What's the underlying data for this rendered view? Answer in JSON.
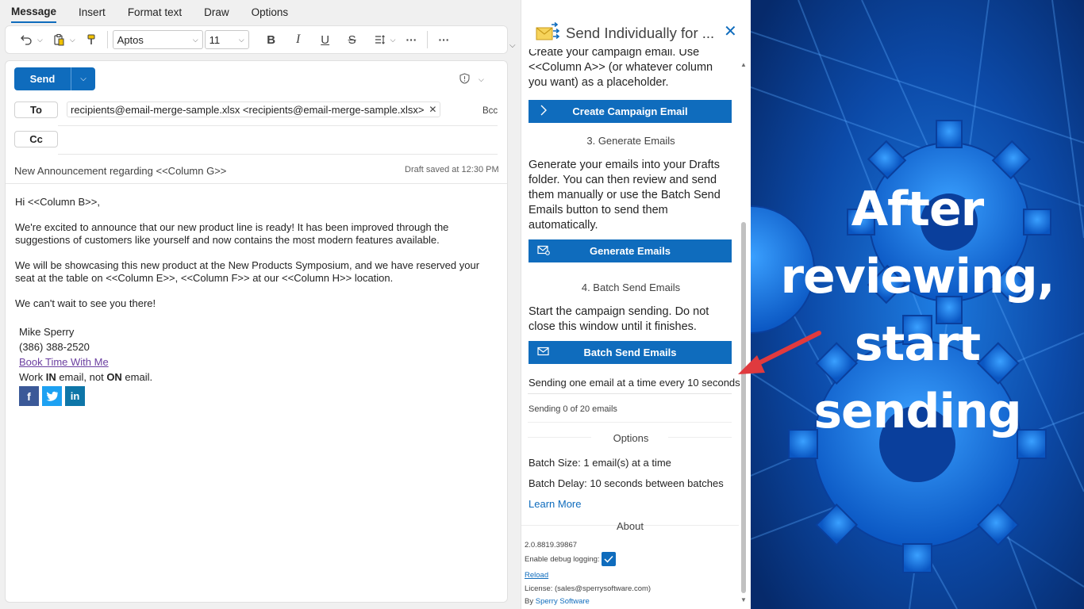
{
  "ribbon": {
    "tabs": [
      "Message",
      "Insert",
      "Format text",
      "Draw",
      "Options"
    ],
    "font_name": "Aptos",
    "font_size": "11"
  },
  "compose": {
    "send_label": "Send",
    "to_label": "To",
    "cc_label": "Cc",
    "bcc_label": "Bcc",
    "recipient": "recipients@email-merge-sample.xlsx <recipients@email-merge-sample.xlsx>",
    "subject": "New Announcement regarding <<Column G>>",
    "draft_status": "Draft saved at 12:30 PM",
    "body": {
      "greeting": "Hi <<Column B>>,",
      "para1": "  We're excited to announce that our new product line is ready!  It has been improved through the suggestions of customers like yourself and now contains the most modern features available.",
      "para2": "  We will be showcasing this new product at the New Products Symposium, and we have reserved your seat at the table on <<Column E>>, <<Column F>> at our <<Column H>> location.",
      "para3": "  We can't wait to see you there!",
      "sig_name": "Mike Sperry",
      "sig_phone": "(386) 388-2520",
      "sig_link": "Book Time With Me",
      "motto_1": "Work ",
      "motto_in": "IN",
      "motto_2": " email, not ",
      "motto_on": "ON",
      "motto_3": " email.",
      "social": [
        "f",
        "t",
        "in"
      ]
    }
  },
  "addin": {
    "title": "Send Individually for ...",
    "step2_text": "Create your campaign email. Use <<Column A>> (or whatever column you want) as a placeholder.",
    "create_btn": "Create Campaign Email",
    "step3_title": "3. Generate Emails",
    "step3_text": "Generate your emails into your Drafts folder. You can then review and send them manually or use the Batch Send Emails button to send them automatically.",
    "generate_btn": "Generate Emails",
    "step4_title": "4. Batch Send Emails",
    "step4_text": "Start the campaign sending. Do not close this window until it finishes.",
    "batch_btn": "Batch Send Emails",
    "sending_rate": "Sending one email at a time every 10 seconds",
    "progress": "Sending 0 of 20 emails",
    "options_title": "Options",
    "batch_size": "Batch Size: 1 email(s) at a time",
    "batch_delay": "Batch Delay: 10 seconds between batches",
    "learn_more": "Learn More",
    "about_title": "About",
    "version": "2.0.8819.39867",
    "debug_label": "Enable debug logging:",
    "debug_enabled": true,
    "reload": "Reload",
    "license": "License: (sales@sperrysoftware.com)",
    "by_label": "By ",
    "by_link": "Sperry Software"
  },
  "banner": {
    "line1": "After",
    "line2": "reviewing,",
    "line3": "start",
    "line4": "sending"
  },
  "colors": {
    "accent": "#0f6cbd",
    "arrow": "#e03a3e",
    "banner_bg": "#0b3d91"
  }
}
